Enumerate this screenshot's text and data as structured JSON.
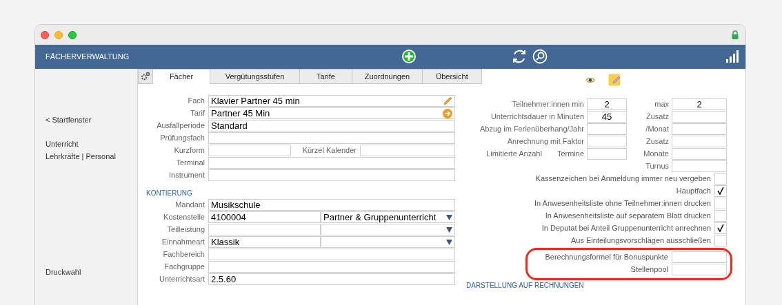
{
  "header": {
    "title": "FÄCHERVERWALTUNG"
  },
  "tabs": [
    {
      "label": "Fächer",
      "selected": true
    },
    {
      "label": "Vergütungsstufen",
      "selected": false
    },
    {
      "label": "Tarife",
      "selected": false
    },
    {
      "label": "Zuordnungen",
      "selected": false
    },
    {
      "label": "Übersicht",
      "selected": false
    }
  ],
  "sidebar": {
    "groups": [
      [
        "< Startfenster"
      ],
      [
        "Unterricht",
        "Lehrkräfte | Personal"
      ],
      [
        "Druckwahl"
      ]
    ]
  },
  "general_fields": [
    {
      "kind": "editable",
      "label": "Fach",
      "value": "Klavier Partner 45 min"
    },
    {
      "kind": "linked",
      "label": "Tarif",
      "value": "Partner 45 Min"
    },
    {
      "kind": "text",
      "label": "Ausfallperiode",
      "value": "Standard"
    },
    {
      "kind": "text",
      "label": "Prüfungsfach"
    },
    {
      "kind": "pair",
      "label": "Kurzform",
      "label2": "Kürzel Kalender"
    },
    {
      "kind": "text",
      "label": "Terminal"
    },
    {
      "kind": "text",
      "label": "Instrument"
    }
  ],
  "kontierung": {
    "title": "KONTIERUNG",
    "fields": [
      {
        "kind": "text",
        "label": "Mandant",
        "value": "Musikschule"
      },
      {
        "kind": "split",
        "label": "Kostenstelle",
        "value": "4100004",
        "option": "Partner & Gruppenunterricht"
      },
      {
        "kind": "split",
        "label": "Teilleistung"
      },
      {
        "kind": "split",
        "label": "Einnahmeart",
        "value": "Klassik"
      },
      {
        "kind": "text",
        "label": "Fachbereich"
      },
      {
        "kind": "text",
        "label": "Fachgruppe"
      },
      {
        "kind": "text",
        "label": "Unterrichtsart",
        "value": "2.5.60"
      }
    ]
  },
  "number_rows": [
    {
      "label": "Teilnehmer:innen min",
      "value": "2",
      "label2": "max",
      "value2": "2"
    },
    {
      "label": "Unterrichtsdauer in Minuten",
      "value": "45",
      "label2": "Zusatz"
    },
    {
      "label": "Abzug im Ferienüberhang/Jahr",
      "label2": "/Monat"
    },
    {
      "label": "Anrechnung mit Faktor",
      "label2": "Zusatz"
    },
    {
      "label": "Limitierte Anzahl",
      "sublabel": "Termine",
      "label2": "Monate"
    },
    {
      "label2": "Turnus"
    }
  ],
  "options": [
    {
      "label": "Kassenzeichen bei Anmeldung immer neu vergeben",
      "checked": false
    },
    {
      "label": "Hauptfach",
      "checked": true
    },
    {
      "label": "In Anwesenheitsliste ohne Teilnehmer:innen drucken",
      "checked": false
    },
    {
      "label": "In Anwesenheitsliste auf separatem Blatt drucken",
      "checked": false
    },
    {
      "label": "In Deputat bei Anteil Gruppenunterricht anrechnen",
      "checked": true
    },
    {
      "label": "Aus Einteilungsvorschlägen ausschließen",
      "checked": false
    }
  ],
  "extra_fields": [
    {
      "label": "Berechnungsformel für Bonuspunkte"
    },
    {
      "label": "Stellenpool"
    }
  ],
  "invoice_section": {
    "title": "DARSTELLUNG AUF RECHNUNGEN"
  }
}
